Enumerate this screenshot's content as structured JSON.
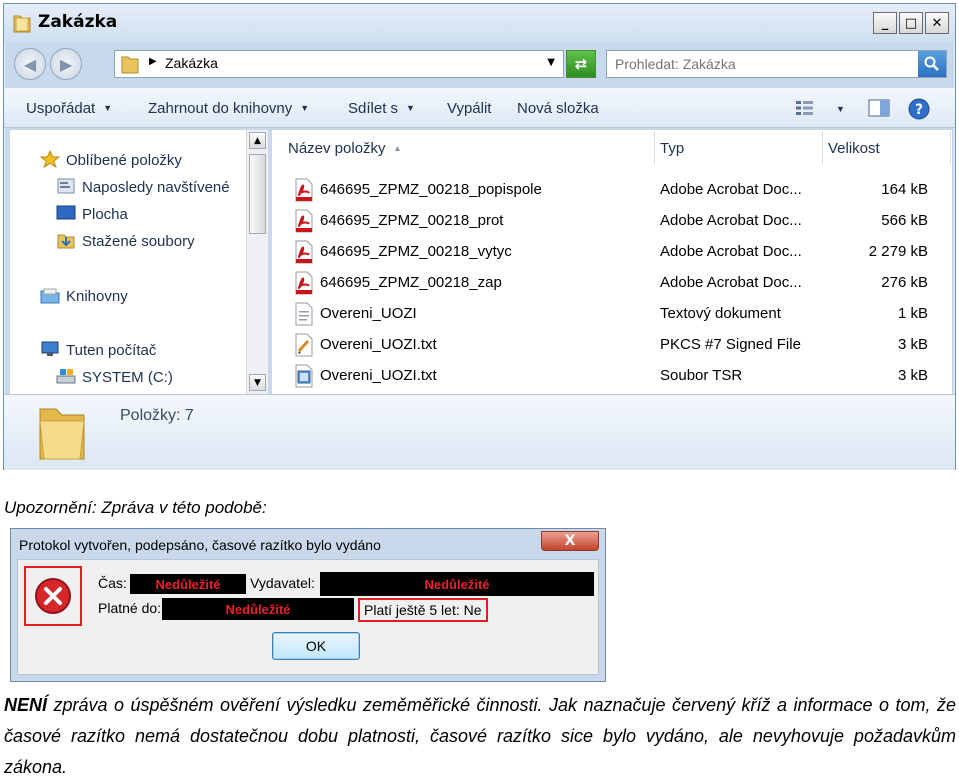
{
  "window": {
    "title": "Zakázka",
    "controls": {
      "minimize": "_",
      "maximize": "□",
      "close": "✕"
    }
  },
  "address": {
    "path": "Zakázka",
    "search_placeholder": "Prohledat: Zakázka"
  },
  "toolbar": {
    "organize": "Uspořádat",
    "include_library": "Zahrnout do knihovny",
    "share": "Sdílet s",
    "burn": "Vypálit",
    "new_folder": "Nová složka"
  },
  "nav": {
    "favorites": "Oblíbené položky",
    "recent": "Naposledy navštívené",
    "desktop": "Plocha",
    "downloads": "Stažené soubory",
    "libraries": "Knihovny",
    "computer": "Tuten počítač",
    "system_drive": "SYSTEM (C:)"
  },
  "columns": {
    "name": "Název položky",
    "type": "Typ",
    "size": "Velikost"
  },
  "files": [
    {
      "name": "646695_ZPMZ_00218_popispole",
      "type": "Adobe Acrobat Doc...",
      "size": "164 kB",
      "icon": "pdf"
    },
    {
      "name": "646695_ZPMZ_00218_prot",
      "type": "Adobe Acrobat Doc...",
      "size": "566 kB",
      "icon": "pdf"
    },
    {
      "name": "646695_ZPMZ_00218_vytyc",
      "type": "Adobe Acrobat Doc...",
      "size": "2 279 kB",
      "icon": "pdf"
    },
    {
      "name": "646695_ZPMZ_00218_zap",
      "type": "Adobe Acrobat Doc...",
      "size": "276 kB",
      "icon": "pdf"
    },
    {
      "name": "Overeni_UOZI",
      "type": "Textový dokument",
      "size": "1 kB",
      "icon": "txt"
    },
    {
      "name": "Overeni_UOZI.txt",
      "type": "PKCS #7 Signed File",
      "size": "3 kB",
      "icon": "p7s"
    },
    {
      "name": "Overeni_UOZI.txt",
      "type": "Soubor TSR",
      "size": "3 kB",
      "icon": "tsr"
    }
  ],
  "details": {
    "count": "Položky: 7"
  },
  "warning_heading": "Upozornění: Zpráva v této podobě:",
  "dialog": {
    "title": "Protokol vytvořen, podepsáno, časové razítko bylo vydáno",
    "close": "X",
    "cas_label": "Čas:",
    "vydavatel_label": "Vydavatel:",
    "platne_label": "Platné do:",
    "redacted": "Nedůležité",
    "plati_text": "Platí ještě 5 let: Ne",
    "ok": "OK"
  },
  "paragraph": {
    "bold": "NENÍ",
    "text": " zpráva o úspěšném ověření výsledku zeměměřické činnosti. Jak naznačuje červený kříž a informace o tom, že časové razítko nemá dostatečnou dobu platnosti, časové razítko sice bylo vydáno, ale nevyhovuje požadavkům zákona."
  },
  "colors": {
    "error_red": "#e02020",
    "window_blue": "#c9d9ec",
    "redact_text": "#e8222a"
  }
}
